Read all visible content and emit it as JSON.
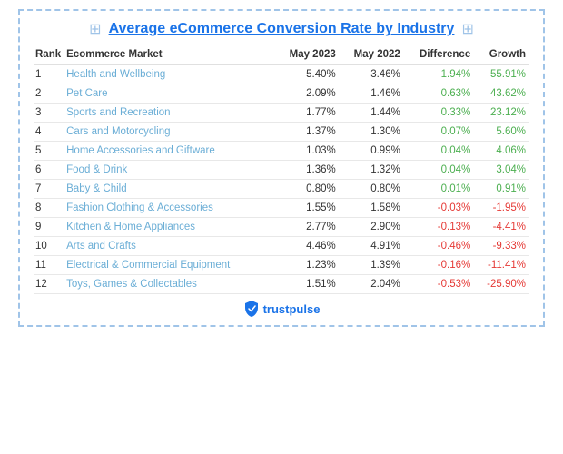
{
  "title": "Average eCommerce Conversion Rate by Industry",
  "table": {
    "headers": [
      "Rank",
      "Ecommerce Market",
      "May 2023",
      "May 2022",
      "Difference",
      "Growth"
    ],
    "rows": [
      {
        "rank": "1",
        "market": "Health and Wellbeing",
        "may2023": "5.40%",
        "may2022": "3.46%",
        "diff": "1.94%",
        "growth": "55.91%",
        "diff_sign": "pos",
        "growth_sign": "pos"
      },
      {
        "rank": "2",
        "market": "Pet Care",
        "may2023": "2.09%",
        "may2022": "1.46%",
        "diff": "0.63%",
        "growth": "43.62%",
        "diff_sign": "pos",
        "growth_sign": "pos"
      },
      {
        "rank": "3",
        "market": "Sports and Recreation",
        "may2023": "1.77%",
        "may2022": "1.44%",
        "diff": "0.33%",
        "growth": "23.12%",
        "diff_sign": "pos",
        "growth_sign": "pos"
      },
      {
        "rank": "4",
        "market": "Cars and Motorcycling",
        "may2023": "1.37%",
        "may2022": "1.30%",
        "diff": "0.07%",
        "growth": "5.60%",
        "diff_sign": "pos",
        "growth_sign": "pos"
      },
      {
        "rank": "5",
        "market": "Home Accessories and Giftware",
        "may2023": "1.03%",
        "may2022": "0.99%",
        "diff": "0.04%",
        "growth": "4.06%",
        "diff_sign": "pos",
        "growth_sign": "pos"
      },
      {
        "rank": "6",
        "market": "Food & Drink",
        "may2023": "1.36%",
        "may2022": "1.32%",
        "diff": "0.04%",
        "growth": "3.04%",
        "diff_sign": "pos",
        "growth_sign": "pos"
      },
      {
        "rank": "7",
        "market": "Baby & Child",
        "may2023": "0.80%",
        "may2022": "0.80%",
        "diff": "0.01%",
        "growth": "0.91%",
        "diff_sign": "pos",
        "growth_sign": "pos"
      },
      {
        "rank": "8",
        "market": "Fashion Clothing & Accessories",
        "may2023": "1.55%",
        "may2022": "1.58%",
        "diff": "-0.03%",
        "growth": "-1.95%",
        "diff_sign": "neg",
        "growth_sign": "neg"
      },
      {
        "rank": "9",
        "market": "Kitchen & Home Appliances",
        "may2023": "2.77%",
        "may2022": "2.90%",
        "diff": "-0.13%",
        "growth": "-4.41%",
        "diff_sign": "neg",
        "growth_sign": "neg"
      },
      {
        "rank": "10",
        "market": "Arts and Crafts",
        "may2023": "4.46%",
        "may2022": "4.91%",
        "diff": "-0.46%",
        "growth": "-9.33%",
        "diff_sign": "neg",
        "growth_sign": "neg"
      },
      {
        "rank": "11",
        "market": "Electrical & Commercial Equipment",
        "may2023": "1.23%",
        "may2022": "1.39%",
        "diff": "-0.16%",
        "growth": "-11.41%",
        "diff_sign": "neg",
        "growth_sign": "neg"
      },
      {
        "rank": "12",
        "market": "Toys, Games & Collectables",
        "may2023": "1.51%",
        "may2022": "2.04%",
        "diff": "-0.53%",
        "growth": "-25.90%",
        "diff_sign": "neg",
        "growth_sign": "neg"
      }
    ]
  },
  "footer": {
    "brand": "trustpulse"
  }
}
